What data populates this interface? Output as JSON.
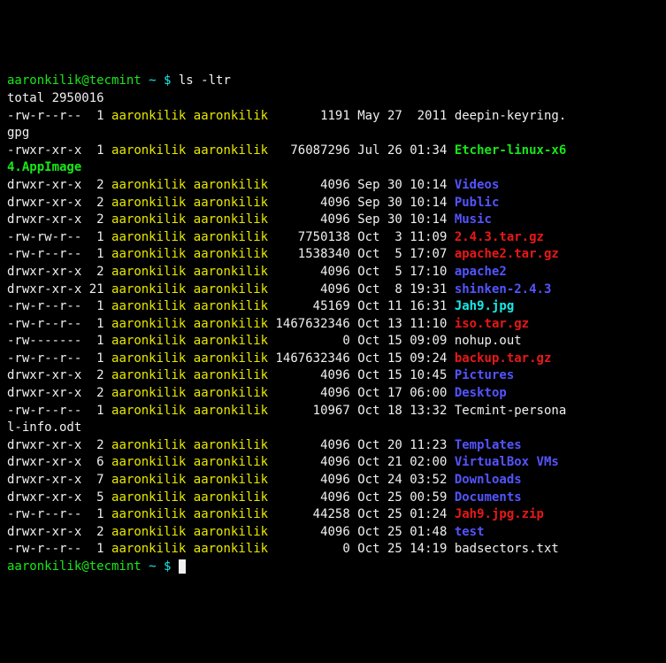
{
  "prompt": {
    "user": "aaronkilik@tecmint",
    "tilde": " ~ $ ",
    "command": "ls -ltr"
  },
  "total": "total 2950016",
  "rows": [
    {
      "perm": "-rw-r--r--",
      "links": "1",
      "owner": "aaronkilik",
      "group": "aaronkilik",
      "size": "1191",
      "date": "May 27  2011",
      "name": "deepin-keyring.",
      "cont": "gpg",
      "cls": "white"
    },
    {
      "perm": "-rwxr-xr-x",
      "links": "1",
      "owner": "aaronkilik",
      "group": "aaronkilik",
      "size": "76087296",
      "date": "Jul 26 01:34",
      "name": "Etcher-linux-x6",
      "cont": "4.AppImage",
      "cls": "green-b"
    },
    {
      "perm": "drwxr-xr-x",
      "links": "2",
      "owner": "aaronkilik",
      "group": "aaronkilik",
      "size": "4096",
      "date": "Sep 30 10:14",
      "name": "Videos",
      "cls": "blue-b"
    },
    {
      "perm": "drwxr-xr-x",
      "links": "2",
      "owner": "aaronkilik",
      "group": "aaronkilik",
      "size": "4096",
      "date": "Sep 30 10:14",
      "name": "Public",
      "cls": "blue-b"
    },
    {
      "perm": "drwxr-xr-x",
      "links": "2",
      "owner": "aaronkilik",
      "group": "aaronkilik",
      "size": "4096",
      "date": "Sep 30 10:14",
      "name": "Music",
      "cls": "blue-b"
    },
    {
      "perm": "-rw-rw-r--",
      "links": "1",
      "owner": "aaronkilik",
      "group": "aaronkilik",
      "size": "7750138",
      "date": "Oct  3 11:09",
      "name": "2.4.3.tar.gz",
      "cls": "red-b"
    },
    {
      "perm": "-rw-r--r--",
      "links": "1",
      "owner": "aaronkilik",
      "group": "aaronkilik",
      "size": "1538340",
      "date": "Oct  5 17:07",
      "name": "apache2.tar.gz",
      "cls": "red-b"
    },
    {
      "perm": "drwxr-xr-x",
      "links": "2",
      "owner": "aaronkilik",
      "group": "aaronkilik",
      "size": "4096",
      "date": "Oct  5 17:10",
      "name": "apache2",
      "cls": "blue-b"
    },
    {
      "perm": "drwxr-xr-x",
      "links": "21",
      "owner": "aaronkilik",
      "group": "aaronkilik",
      "size": "4096",
      "date": "Oct  8 19:31",
      "name": "shinken-2.4.3",
      "cls": "blue-b"
    },
    {
      "perm": "-rw-r--r--",
      "links": "1",
      "owner": "aaronkilik",
      "group": "aaronkilik",
      "size": "45169",
      "date": "Oct 11 16:31",
      "name": "Jah9.jpg",
      "cls": "cyan-b"
    },
    {
      "perm": "-rw-r--r--",
      "links": "1",
      "owner": "aaronkilik",
      "group": "aaronkilik",
      "size": "1467632346",
      "date": "Oct 13 11:10",
      "name": "iso.tar.gz",
      "cls": "red-b"
    },
    {
      "perm": "-rw-------",
      "links": "1",
      "owner": "aaronkilik",
      "group": "aaronkilik",
      "size": "0",
      "date": "Oct 15 09:09",
      "name": "nohup.out",
      "cls": "white"
    },
    {
      "perm": "-rw-r--r--",
      "links": "1",
      "owner": "aaronkilik",
      "group": "aaronkilik",
      "size": "1467632346",
      "date": "Oct 15 09:24",
      "name": "backup.tar.gz",
      "cls": "red-b"
    },
    {
      "perm": "drwxr-xr-x",
      "links": "2",
      "owner": "aaronkilik",
      "group": "aaronkilik",
      "size": "4096",
      "date": "Oct 15 10:45",
      "name": "Pictures",
      "cls": "blue-b"
    },
    {
      "perm": "drwxr-xr-x",
      "links": "2",
      "owner": "aaronkilik",
      "group": "aaronkilik",
      "size": "4096",
      "date": "Oct 17 06:00",
      "name": "Desktop",
      "cls": "blue-b"
    },
    {
      "perm": "-rw-r--r--",
      "links": "1",
      "owner": "aaronkilik",
      "group": "aaronkilik",
      "size": "10967",
      "date": "Oct 18 13:32",
      "name": "Tecmint-persona",
      "cont": "l-info.odt",
      "cls": "white"
    },
    {
      "perm": "drwxr-xr-x",
      "links": "2",
      "owner": "aaronkilik",
      "group": "aaronkilik",
      "size": "4096",
      "date": "Oct 20 11:23",
      "name": "Templates",
      "cls": "blue-b"
    },
    {
      "perm": "drwxr-xr-x",
      "links": "6",
      "owner": "aaronkilik",
      "group": "aaronkilik",
      "size": "4096",
      "date": "Oct 21 02:00",
      "name": "VirtualBox VMs",
      "cls": "blue-b"
    },
    {
      "perm": "drwxr-xr-x",
      "links": "7",
      "owner": "aaronkilik",
      "group": "aaronkilik",
      "size": "4096",
      "date": "Oct 24 03:52",
      "name": "Downloads",
      "cls": "blue-b"
    },
    {
      "perm": "drwxr-xr-x",
      "links": "5",
      "owner": "aaronkilik",
      "group": "aaronkilik",
      "size": "4096",
      "date": "Oct 25 00:59",
      "name": "Documents",
      "cls": "blue-b"
    },
    {
      "perm": "-rw-r--r--",
      "links": "1",
      "owner": "aaronkilik",
      "group": "aaronkilik",
      "size": "44258",
      "date": "Oct 25 01:24",
      "name": "Jah9.jpg.zip",
      "cls": "red-b"
    },
    {
      "perm": "drwxr-xr-x",
      "links": "2",
      "owner": "aaronkilik",
      "group": "aaronkilik",
      "size": "4096",
      "date": "Oct 25 01:48",
      "name": "test",
      "cls": "blue-b"
    },
    {
      "perm": "-rw-r--r--",
      "links": "1",
      "owner": "aaronkilik",
      "group": "aaronkilik",
      "size": "0",
      "date": "Oct 25 14:19",
      "name": "badsectors.txt",
      "cls": "white"
    }
  ]
}
